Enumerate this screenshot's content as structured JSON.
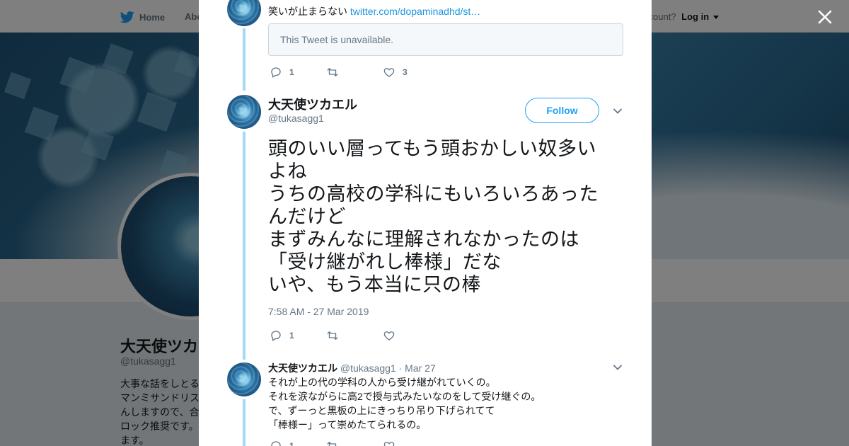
{
  "nav": {
    "home": "Home",
    "about": "Abo",
    "account_prompt": "ccount?",
    "login": "Log in"
  },
  "profile": {
    "name": "大天使ツカエ",
    "handle": "@tukasagg1",
    "bio_lines": [
      "大事な話をしとる",
      "マンミサンドリス",
      "んしますので、合",
      "ロック推奨です。",
      "ます。"
    ]
  },
  "prev_tweet": {
    "text": "笑いが止まらない ",
    "link": "twitter.com/dopaminadhd/st…",
    "quote_unavailable": "This Tweet is unavailable.",
    "replies": "1",
    "likes": "3"
  },
  "main_tweet": {
    "name": "大天使ツカエル",
    "handle": "@tukasagg1",
    "follow_label": "Follow",
    "text_lines": [
      "頭のいい層ってもう頭おかしい奴多い",
      "よね",
      "うちの高校の学科にもいろいろあった",
      "んだけど",
      "まずみんなに理解されなかったのは",
      "「受け継がれし棒様」だな",
      "いや、もう本当に只の棒"
    ],
    "timestamp": "7:58 AM - 27 Mar 2019",
    "replies": "1"
  },
  "reply_tweet": {
    "name": "大天使ツカエル",
    "handle": "@tukasagg1",
    "sep": " · ",
    "date": "Mar 27",
    "text_lines": [
      "それが上の代の学科の人から受け継がれていくの。",
      "それを涙ながらに高2で授与式みたいなのをして受け継ぐの。",
      "で、ずーっと黒板の上にきっちり吊り下げられてて",
      "「棒様ー」って崇めたてられるの。"
    ],
    "replies": "1"
  },
  "colors": {
    "accent": "#1da1f2",
    "link": "#1b95e0",
    "thread_line": "#a4d9f5",
    "muted": "#657786"
  }
}
